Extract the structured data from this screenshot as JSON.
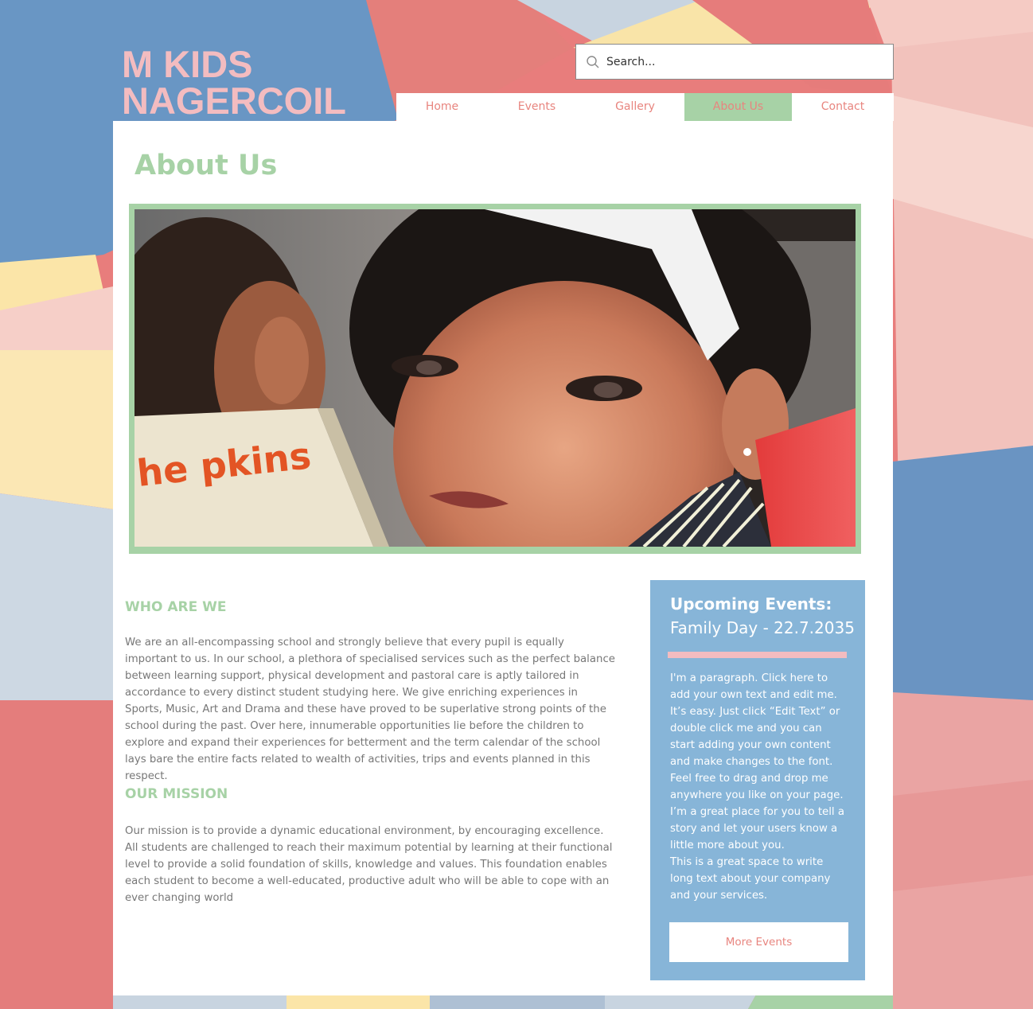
{
  "site": {
    "title_line1": "M KIDS",
    "title_line2": "NAGERCOIL"
  },
  "search": {
    "placeholder": "Search...",
    "icon": "search-icon"
  },
  "nav": {
    "items": [
      {
        "label": "Home",
        "active": false
      },
      {
        "label": "Events",
        "active": false
      },
      {
        "label": "Gallery",
        "active": false
      },
      {
        "label": "About Us",
        "active": true
      },
      {
        "label": "Contact",
        "active": false
      }
    ]
  },
  "page": {
    "heading": "About Us"
  },
  "hero": {
    "book_text": "he pkins"
  },
  "who": {
    "heading": "WHO ARE WE",
    "text": "We are an all-encompassing school and strongly believe that every pupil is equally important to us. In our school, a plethora of specialised services such as the perfect balance between learning support, physical development and pastoral care is aptly tailored in accordance to every distinct student studying here.  We give enriching experiences in Sports, Music, Art and Drama and these have proved to be superlative strong points of the school during the past. Over here, innumerable opportunities lie before the children to explore and expand their experiences for betterment and the term calendar of the school lays bare the entire facts related to wealth of activities, trips and events planned in this respect."
  },
  "mission": {
    "heading": "OUR MISSION",
    "text": "Our mission is to provide a dynamic educational environment, by encouraging excellence. All students are challenged to reach their maximum potential by learning at their functional level to provide a solid foundation of skills, knowledge and values. This foundation enables each student to become a well-educated, productive adult who will be able to cope with an ever changing world"
  },
  "events": {
    "title": "Upcoming Events:",
    "date": "Family Day - 22.7.2035",
    "paragraph1": "I'm a paragraph. Click here to add your own text and edit me. It’s easy. Just click “Edit Text” or double click me and you can start adding your own content and make changes to the font. Feel free to drag and drop me anywhere you like on your page. I’m a great place for you to tell a story and let your users know a little more about you.",
    "paragraph2": "This is a great space to write long text about your company and your services.",
    "button_label": "More Events"
  },
  "colors": {
    "accent_green": "#a7d2a6",
    "accent_pink": "#f3bcc0",
    "nav_text": "#e8857f",
    "panel_blue": "#87b5d8",
    "body_text": "#777777"
  }
}
